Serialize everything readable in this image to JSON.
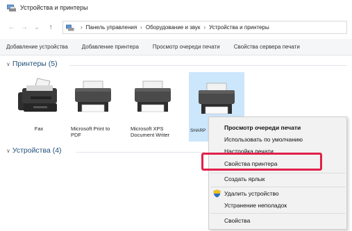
{
  "window": {
    "title": "Устройства и принтеры"
  },
  "nav": {
    "back": "←",
    "forward": "→",
    "up": "↑"
  },
  "breadcrumb": {
    "items": [
      "Панель управления",
      "Оборудование и звук",
      "Устройства и принтеры"
    ],
    "separator": "›"
  },
  "toolbar": {
    "buttons": [
      "Добавление устройства",
      "Добавление принтера",
      "Просмотр очереди печати",
      "Свойства сервера печати"
    ]
  },
  "groups": {
    "printers": {
      "label": "Принтеры (5)",
      "chevron": "∨"
    },
    "devices": {
      "label": "Устройства (4)",
      "chevron": "∨"
    }
  },
  "printers": [
    {
      "label": "Fax",
      "icon": "fax-icon"
    },
    {
      "label": "Microsoft Print to PDF",
      "icon": "printer-icon"
    },
    {
      "label": "Microsoft XPS Document Writer",
      "icon": "printer-icon"
    },
    {
      "label": "SHARP",
      "icon": "printer-icon",
      "selected": true
    }
  ],
  "context_menu": {
    "items": [
      "Просмотр очереди печати",
      "Использовать по умолчанию",
      "Настройка печати",
      "Свойства принтера",
      "Создать ярлык",
      "Удалить устройство",
      "Устранение неполадок",
      "Свойства"
    ]
  },
  "colors": {
    "highlight": "#e0204a",
    "selection": "#cce6fb",
    "group_header": "#1e4e79"
  }
}
